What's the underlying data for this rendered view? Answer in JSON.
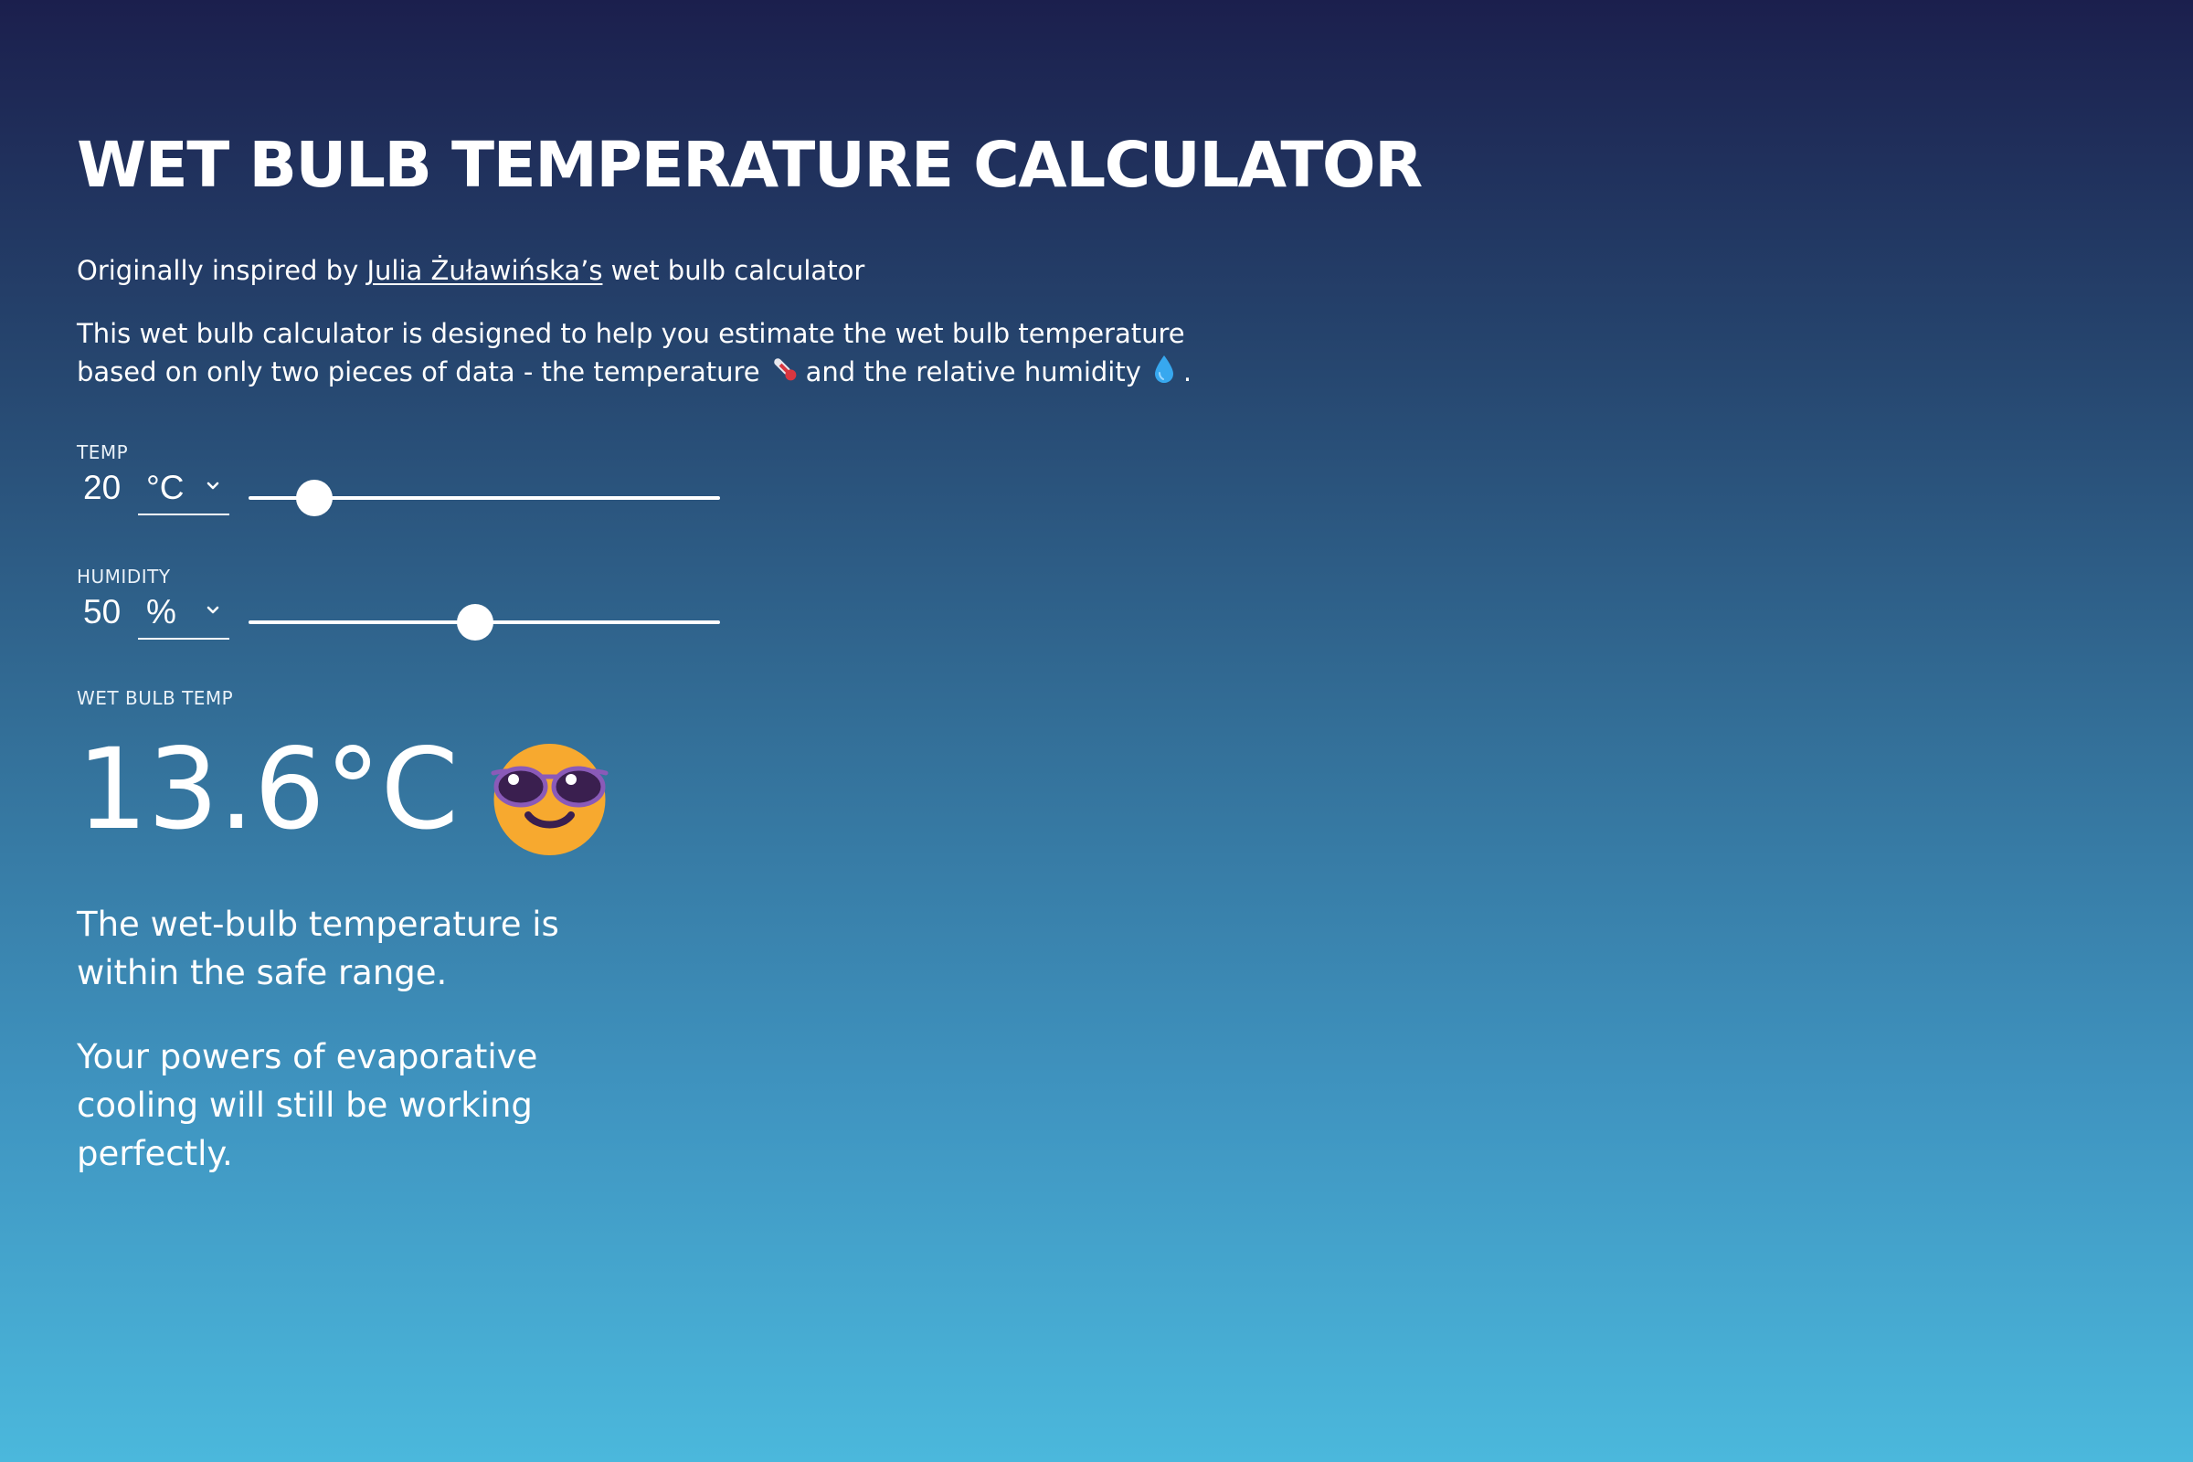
{
  "title": "WET BULB TEMPERATURE CALCULATOR",
  "credit": {
    "prefix": "Originally inspired by ",
    "link_text": "Julia Żuławińska’s",
    "suffix": " wet bulb calculator"
  },
  "intro": {
    "line1": "This wet bulb calculator is designed to help you estimate the wet bulb temperature",
    "line2_start": "based on only two pieces of data - the temperature",
    "line2_mid": "and the relative humidity",
    "line2_end": ".",
    "thermometer_icon": "thermometer-icon",
    "droplet_icon": "droplet-icon"
  },
  "temp": {
    "label": "TEMP",
    "value": "20",
    "unit": "°C",
    "slider_fraction": 0.14
  },
  "humidity": {
    "label": "HUMIDITY",
    "value": "50",
    "unit": "%",
    "slider_fraction": 0.48
  },
  "result": {
    "label": "WET BULB TEMP",
    "value": "13.6°C",
    "emoji_icon": "sunglasses-smiley-icon"
  },
  "messages": {
    "line1": "The wet-bulb temperature is within the safe range.",
    "line2": "Your powers of evaporative cooling will still be working perfectly."
  },
  "colors": {
    "gradient_top": "#1b1f4d",
    "gradient_bottom": "#4bb8dc",
    "text": "#ffffff",
    "emoji_face": "#f7a92f",
    "glasses": "#3a1f4f"
  }
}
